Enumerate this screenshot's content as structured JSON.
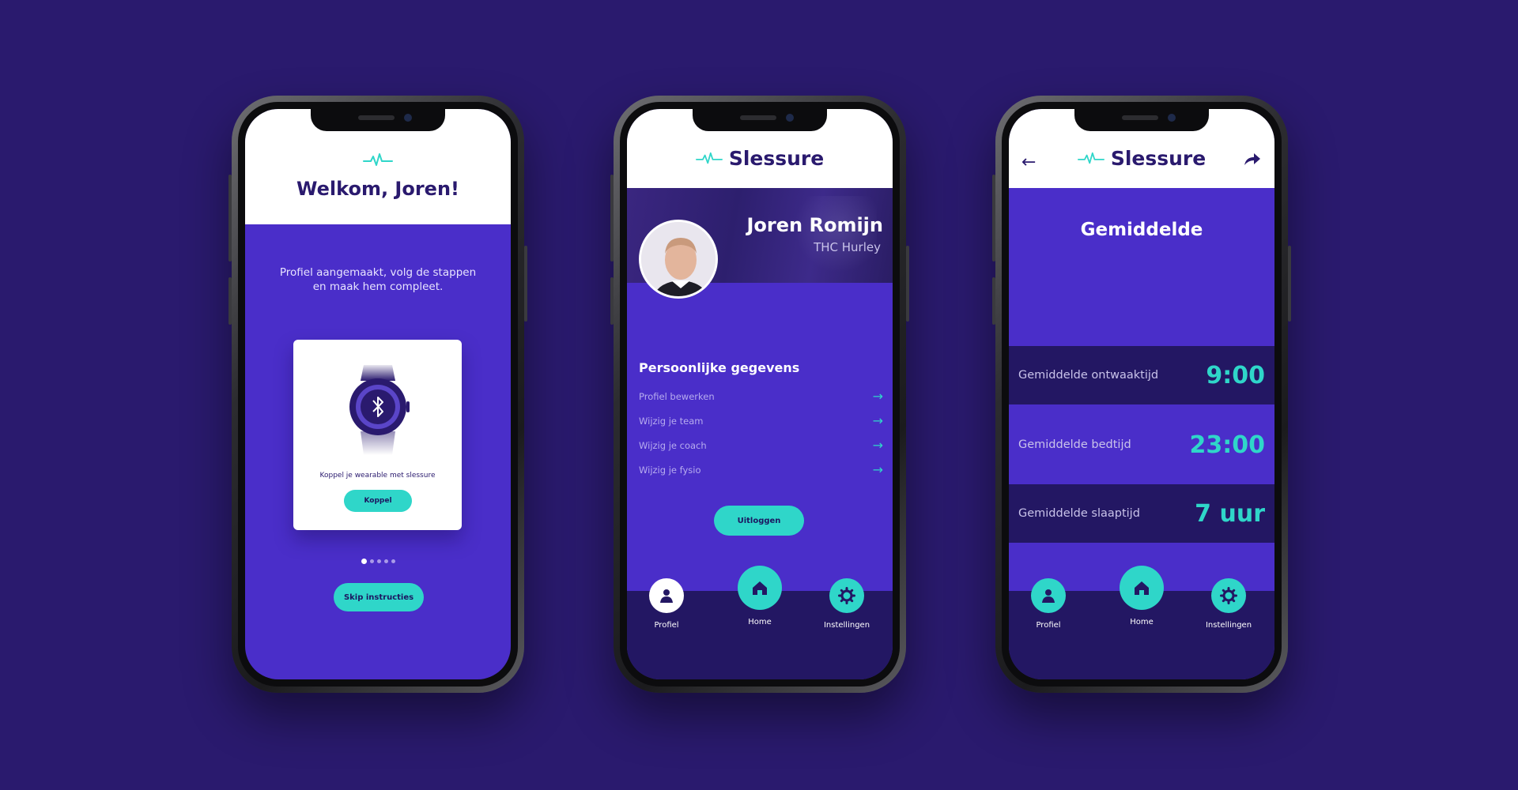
{
  "colors": {
    "background": "#2a1a6e",
    "primary": "#4a2ec9",
    "accent": "#2fd6c9",
    "dark": "#231763"
  },
  "screen1": {
    "title": "Welkom, Joren!",
    "intro": "Profiel aangemaakt, volg de stappen en maak hem compleet.",
    "card_text": "Koppel je wearable met slessure",
    "koppel_label": "Koppel",
    "skip_label": "Skip instructies",
    "pages_total": 5,
    "page_current": 1
  },
  "screen2": {
    "brand": "Slessure",
    "name": "Joren Romijn",
    "team": "THC Hurley",
    "section_title": "Persoonlijke gegevens",
    "menu": [
      {
        "label": "Profiel bewerken"
      },
      {
        "label": "Wijzig je team"
      },
      {
        "label": "Wijzig je coach"
      },
      {
        "label": "Wijzig je fysio"
      }
    ],
    "logout_label": "Uitloggen"
  },
  "screen3": {
    "brand": "Slessure",
    "heading": "Gemiddelde",
    "stats": [
      {
        "label": "Gemiddelde ontwaaktijd",
        "value": "9:00"
      },
      {
        "label": "Gemiddelde bedtijd",
        "value": "23:00"
      },
      {
        "label": "Gemiddelde slaaptijd",
        "value": "7 uur"
      }
    ]
  },
  "nav": {
    "profile": "Profiel",
    "home": "Home",
    "settings": "Instellingen"
  }
}
